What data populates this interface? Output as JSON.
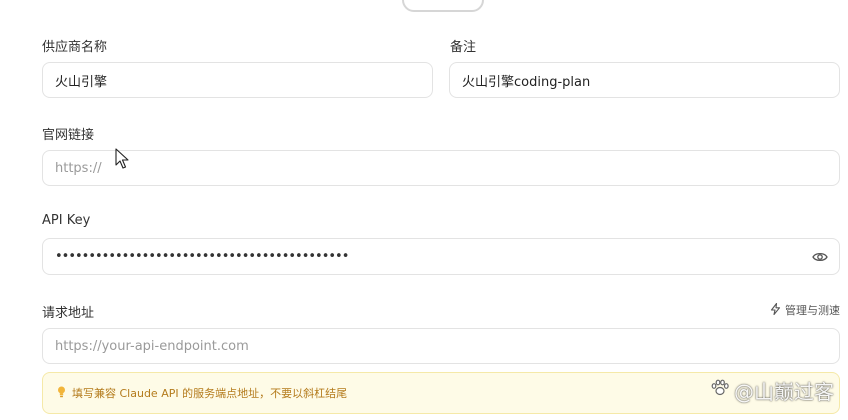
{
  "form": {
    "provider_name": {
      "label": "供应商名称",
      "value": "火山引擎"
    },
    "note": {
      "label": "备注",
      "value": "火山引擎coding-plan"
    },
    "website": {
      "label": "官网链接",
      "placeholder": "https://"
    },
    "api_key": {
      "label": "API Key",
      "value": "••••••••••••••••••••••••••••••••••••••••••••",
      "eye_icon": "eye-icon"
    },
    "endpoint": {
      "label": "请求地址",
      "placeholder": "https://your-api-endpoint.com",
      "manage_label": "管理与测速",
      "manage_icon": "lightning-icon"
    },
    "hint": {
      "icon": "lightbulb-icon",
      "text": "填写兼容 Claude API 的服务端点地址，不要以斜杠结尾"
    }
  },
  "watermark": {
    "icon": "paw-icon",
    "text": "@山巅过客"
  },
  "colors": {
    "border": "#e3e3e3",
    "hint_bg": "#fefbe7",
    "hint_text": "#b47b1c"
  }
}
